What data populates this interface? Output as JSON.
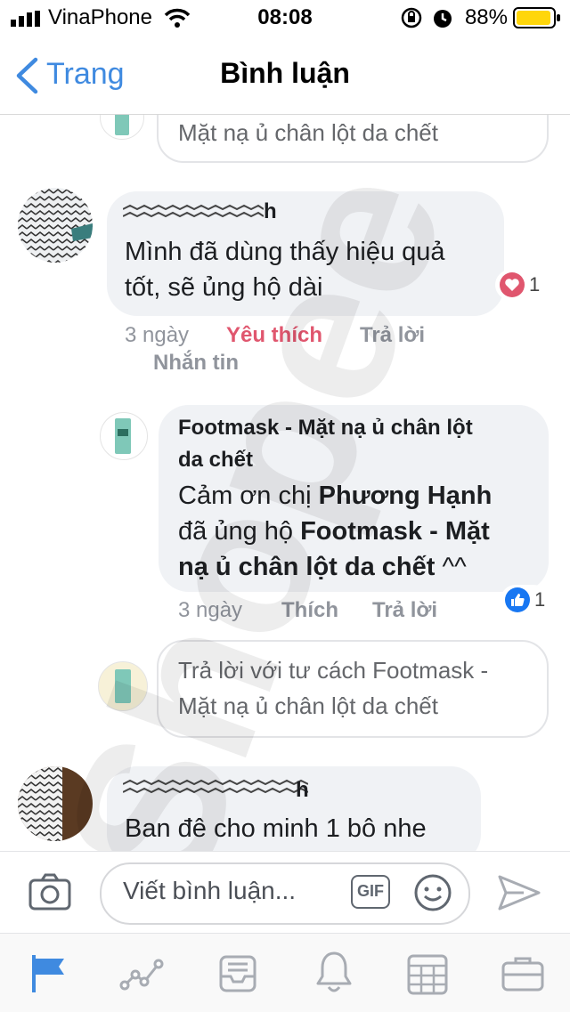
{
  "status_bar": {
    "carrier": "VinaPhone",
    "time": "08:08",
    "battery": "88%"
  },
  "nav": {
    "back_label": "Trang",
    "title": "Bình luận"
  },
  "top_reply_box": {
    "text": "Mặt nạ ủ chân lột da chết"
  },
  "comment1": {
    "name": "h",
    "text_line1": "Mình đã dùng thấy hiệu quả",
    "text_line2": "tốt, sẽ ủng hộ dài",
    "reaction_count": "1",
    "time": "3 ngày",
    "like": "Yêu thích",
    "reply": "Trả lời",
    "message": "Nhắn tin"
  },
  "page_reply": {
    "name_line1": "Footmask - Mặt nạ ủ chân lột",
    "name_line2": "da chết",
    "text_p1": "Cảm ơn chị ",
    "text_b1": "Phương Hạnh",
    "text_p2": "đã ủng hộ ",
    "text_b2": "Footmask - Mặt",
    "text_b3": "nạ ủ chân lột da chết",
    "text_p3": " ^^",
    "reaction_count": "1",
    "time": "3 ngày",
    "like": "Thích",
    "reply": "Trả lời"
  },
  "reply_as_box": {
    "line1": "Trả lời với tư cách Footmask -",
    "line2": "Mặt nạ ủ chân lột da chết"
  },
  "comment2": {
    "name": "h",
    "text": "Ban đê cho minh 1 bô nhe"
  },
  "composer": {
    "placeholder": "Viết bình luận...",
    "gif": "GIF"
  },
  "watermark": {
    "text": "Shopee"
  },
  "colors": {
    "accent": "#3f8ae0",
    "love": "#e0566e",
    "like_blue": "#1877f2",
    "bubble": "#f0f2f5"
  }
}
